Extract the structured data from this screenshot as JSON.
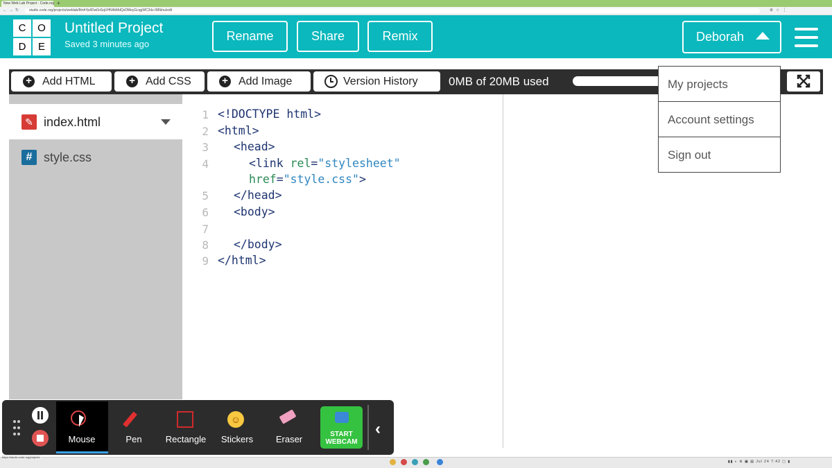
{
  "browser": {
    "tab_title": "New Web Lab Project - Code.org",
    "url": "studio.code.org/projects/weblab/8mhYp4Dw0oSqUHN4kMdQxDMeyGcqgWC2dz-0iBkhu/edit",
    "status_url": "https://studio.code.org/projects"
  },
  "logo": {
    "letters": [
      "C",
      "O",
      "D",
      "E"
    ]
  },
  "header": {
    "title": "Untitled Project",
    "saved": "Saved 3 minutes ago",
    "buttons": {
      "rename": "Rename",
      "share": "Share",
      "remix": "Remix"
    },
    "user": "Deborah"
  },
  "user_menu": {
    "items": [
      "My projects",
      "Account settings",
      "Sign out"
    ]
  },
  "toolbar": {
    "add_html": "Add HTML",
    "add_css": "Add CSS",
    "add_image": "Add Image",
    "version_history": "Version History",
    "storage": "0MB of 20MB used",
    "storage_used_fraction": 0.0
  },
  "files": [
    {
      "name": "index.html",
      "active": true
    },
    {
      "name": "style.css",
      "active": false
    }
  ],
  "editor": {
    "line_numbers": [
      "1",
      "2",
      "3",
      "4",
      "5",
      "6",
      "7",
      "8",
      "9"
    ],
    "code": {
      "l1": "<!DOCTYPE html>",
      "l2": "<html>",
      "l3": "<head>",
      "l4_open": "<link ",
      "l4_attr": "rel",
      "l4_eq": "=",
      "l4_val": "\"stylesheet\"",
      "l4b_attr": "href",
      "l4b_eq": "=",
      "l4b_val": "\"style.css\"",
      "l4b_close": ">",
      "l5": "</head>",
      "l6": "<body>",
      "l8": "</body>",
      "l9": "</html>"
    }
  },
  "recorder": {
    "tools": [
      "Mouse",
      "Pen",
      "Rectangle",
      "Stickers",
      "Eraser"
    ],
    "webcam": [
      "START",
      "WEBCAM"
    ]
  },
  "taskbar": {
    "date": "Jul 24",
    "time": "7:42"
  },
  "colors": {
    "header": "#0ab8bd",
    "toolbar": "#2e2e2e",
    "sidebar": "#c8c8c8",
    "webcam": "#35c240"
  }
}
